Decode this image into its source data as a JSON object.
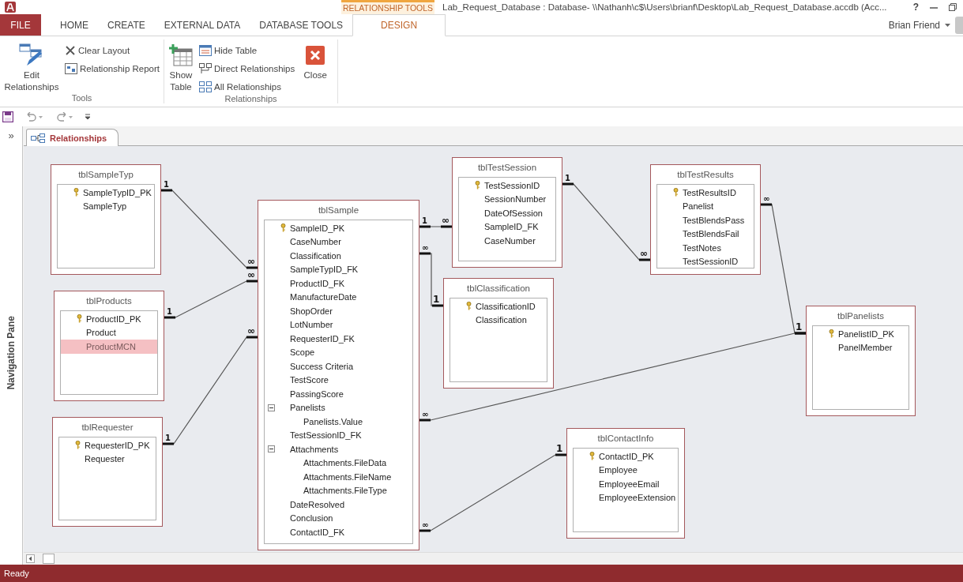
{
  "window": {
    "title": "Lab_Request_Database : Database- \\\\Nathanh\\c$\\Users\\brianf\\Desktop\\Lab_Request_Database.accdb (Acc...",
    "contextual_tab_group": "RELATIONSHIP TOOLS",
    "help": "?"
  },
  "ribbon_tabs": [
    {
      "label": "FILE",
      "kind": "file",
      "selected": false
    },
    {
      "label": "HOME",
      "kind": "normal",
      "selected": false
    },
    {
      "label": "CREATE",
      "kind": "normal",
      "selected": false
    },
    {
      "label": "EXTERNAL DATA",
      "kind": "normal",
      "selected": false
    },
    {
      "label": "DATABASE TOOLS",
      "kind": "normal",
      "selected": false
    },
    {
      "label": "DESIGN",
      "kind": "contextual",
      "selected": true
    }
  ],
  "user": {
    "name": "Brian Friend"
  },
  "ribbon_groups": [
    {
      "label": "Tools",
      "commands": [
        {
          "label": "Edit Relationships",
          "kind": "large"
        },
        {
          "label": "Clear Layout",
          "kind": "small"
        },
        {
          "label": "Relationship Report",
          "kind": "small"
        }
      ]
    },
    {
      "label": "Relationships",
      "commands": [
        {
          "label": "Show Table",
          "kind": "large"
        },
        {
          "label": "Hide Table",
          "kind": "small"
        },
        {
          "label": "Direct Relationships",
          "kind": "small"
        },
        {
          "label": "All Relationships",
          "kind": "small"
        },
        {
          "label": "Close",
          "kind": "large"
        }
      ]
    }
  ],
  "navigation_pane": {
    "toggle": "»",
    "label": "Navigation Pane"
  },
  "document_tabs": [
    {
      "label": "Relationships",
      "selected": true
    }
  ],
  "tables": [
    {
      "name": "tblSampleTyp",
      "fields": [
        {
          "name": "SampleTypID_PK",
          "primary_key": true,
          "selected": false
        },
        {
          "name": "SampleTyp",
          "primary_key": false,
          "selected": false
        }
      ]
    },
    {
      "name": "tblProducts",
      "fields": [
        {
          "name": "ProductID_PK",
          "primary_key": true,
          "selected": false
        },
        {
          "name": "Product",
          "primary_key": false,
          "selected": false
        },
        {
          "name": "ProductMCN",
          "primary_key": false,
          "selected": true
        }
      ]
    },
    {
      "name": "tblRequester",
      "fields": [
        {
          "name": "RequesterID_PK",
          "primary_key": true,
          "selected": false
        },
        {
          "name": "Requester",
          "primary_key": false,
          "selected": false
        }
      ]
    },
    {
      "name": "tblSample",
      "fields": [
        {
          "name": "SampleID_PK",
          "primary_key": true,
          "selected": false
        },
        {
          "name": "CaseNumber",
          "primary_key": false,
          "selected": false
        },
        {
          "name": "Classification",
          "primary_key": false,
          "selected": false
        },
        {
          "name": "SampleTypID_FK",
          "primary_key": false,
          "selected": false
        },
        {
          "name": "ProductID_FK",
          "primary_key": false,
          "selected": false
        },
        {
          "name": "ManufactureDate",
          "primary_key": false,
          "selected": false
        },
        {
          "name": "ShopOrder",
          "primary_key": false,
          "selected": false
        },
        {
          "name": "LotNumber",
          "primary_key": false,
          "selected": false
        },
        {
          "name": "RequesterID_FK",
          "primary_key": false,
          "selected": false
        },
        {
          "name": "Scope",
          "primary_key": false,
          "selected": false
        },
        {
          "name": "Success Criteria",
          "primary_key": false,
          "selected": false
        },
        {
          "name": "TestScore",
          "primary_key": false,
          "selected": false
        },
        {
          "name": "PassingScore",
          "primary_key": false,
          "selected": false
        },
        {
          "name": "Panelists",
          "primary_key": false,
          "selected": false,
          "expanded": true,
          "children": [
            {
              "name": "Panelists.Value",
              "primary_key": false,
              "selected": false
            }
          ]
        },
        {
          "name": "TestSessionID_FK",
          "primary_key": false,
          "selected": false
        },
        {
          "name": "Attachments",
          "primary_key": false,
          "selected": false,
          "expanded": true,
          "children": [
            {
              "name": "Attachments.FileData",
              "primary_key": false,
              "selected": false
            },
            {
              "name": "Attachments.FileName",
              "primary_key": false,
              "selected": false
            },
            {
              "name": "Attachments.FileType",
              "primary_key": false,
              "selected": false
            }
          ]
        },
        {
          "name": "DateResolved",
          "primary_key": false,
          "selected": false
        },
        {
          "name": "Conclusion",
          "primary_key": false,
          "selected": false
        },
        {
          "name": "ContactID_FK",
          "primary_key": false,
          "selected": false
        }
      ]
    },
    {
      "name": "tblTestSession",
      "fields": [
        {
          "name": "TestSessionID",
          "primary_key": true,
          "selected": false
        },
        {
          "name": "SessionNumber",
          "primary_key": false,
          "selected": false
        },
        {
          "name": "DateOfSession",
          "primary_key": false,
          "selected": false
        },
        {
          "name": "SampleID_FK",
          "primary_key": false,
          "selected": false
        },
        {
          "name": "CaseNumber",
          "primary_key": false,
          "selected": false
        }
      ]
    },
    {
      "name": "tblClassification",
      "fields": [
        {
          "name": "ClassificationID",
          "primary_key": true,
          "selected": false
        },
        {
          "name": "Classification",
          "primary_key": false,
          "selected": false
        }
      ]
    },
    {
      "name": "tblTestResults",
      "fields": [
        {
          "name": "TestResultsID",
          "primary_key": true,
          "selected": false
        },
        {
          "name": "Panelist",
          "primary_key": false,
          "selected": false
        },
        {
          "name": "TestBlendsPass",
          "primary_key": false,
          "selected": false
        },
        {
          "name": "TestBlendsFail",
          "primary_key": false,
          "selected": false
        },
        {
          "name": "TestNotes",
          "primary_key": false,
          "selected": false
        },
        {
          "name": "TestSessionID",
          "primary_key": false,
          "selected": false
        }
      ]
    },
    {
      "name": "tblPanelists",
      "fields": [
        {
          "name": "PanelistID_PK",
          "primary_key": true,
          "selected": false
        },
        {
          "name": "PanelMember",
          "primary_key": false,
          "selected": false
        }
      ]
    },
    {
      "name": "tblContactInfo",
      "fields": [
        {
          "name": "ContactID_PK",
          "primary_key": true,
          "selected": false
        },
        {
          "name": "Employee",
          "primary_key": false,
          "selected": false
        },
        {
          "name": "EmployeeEmail",
          "primary_key": false,
          "selected": false
        },
        {
          "name": "EmployeeExtension",
          "primary_key": false,
          "selected": false
        }
      ]
    }
  ],
  "relationships": [
    {
      "from_label": "1",
      "to_label": "∞"
    },
    {
      "from_label": "1",
      "to_label": "∞"
    },
    {
      "from_label": "1",
      "to_label": "∞"
    },
    {
      "from_label": "1",
      "to_label": "∞"
    },
    {
      "from_label": "∞",
      "to_label": "1"
    },
    {
      "from_label": "1",
      "to_label": "∞"
    },
    {
      "from_label": "∞"
    },
    {
      "from_label": "∞",
      "to_label": "1"
    },
    {
      "from_label": "∞",
      "to_label": "1"
    }
  ],
  "status_bar": {
    "text": "Ready"
  }
}
